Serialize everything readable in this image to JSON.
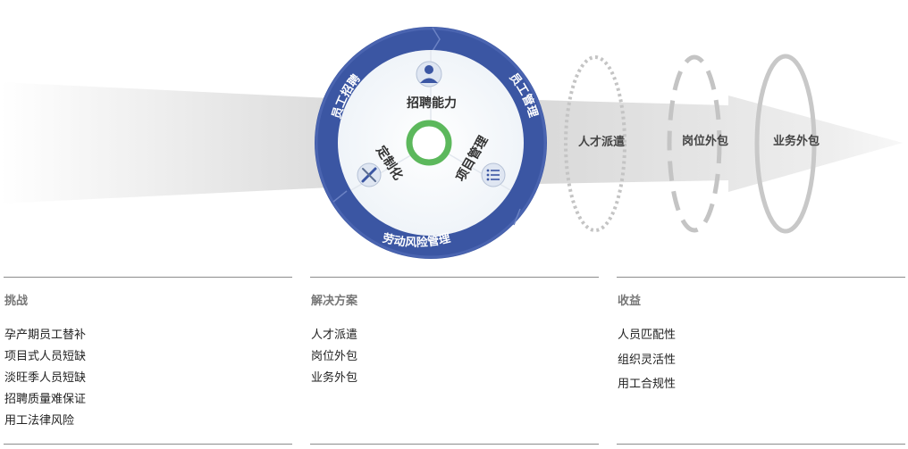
{
  "diagram": {
    "center_title": "招聘能力",
    "center_left": "定制化",
    "center_right": "项目管理",
    "ring_top_left": "员工招聘",
    "ring_top_right": "员工管理",
    "ring_bottom": "劳动风险管理",
    "stage_1": "人才派遣",
    "stage_2": "岗位外包",
    "stage_3": "业务外包",
    "colors": {
      "ring": "#3b56a3",
      "core_ring": "#5cb85c",
      "arrow": "#e6e6e6",
      "dash": "#c8c8c8"
    }
  },
  "columns": [
    {
      "title": "挑战",
      "items": [
        "孕产期员工替补",
        "项目式人员短缺",
        "淡旺季人员短缺",
        "招聘质量难保证",
        "用工法律风险"
      ]
    },
    {
      "title": "解决方案",
      "items": [
        "人才派遣",
        "岗位外包",
        "业务外包"
      ]
    },
    {
      "title": "收益",
      "items": [
        "人员匹配性",
        "组织灵活性",
        "用工合规性"
      ]
    }
  ]
}
